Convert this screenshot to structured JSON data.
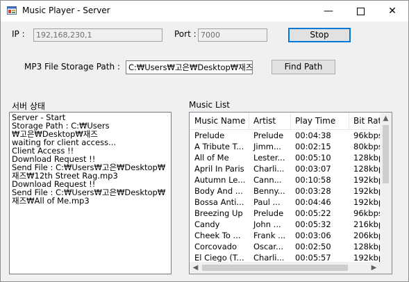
{
  "window": {
    "title": "Music Player - Server",
    "min_glyph": "—",
    "close_glyph": "✕"
  },
  "connection": {
    "ip_label": "IP :",
    "ip_value": "192,168,230,1",
    "port_label": "Port :",
    "port_value": "7000",
    "stop_label": "Stop"
  },
  "storage": {
    "path_label": "MP3 File Storage Path :",
    "path_value": "C:₩Users₩고은₩Desktop₩재즈",
    "find_label": "Find Path"
  },
  "server_status": {
    "heading": "서버 상태",
    "lines": [
      "Server - Start",
      "Storage Path : C:₩Users",
      "₩고은₩Desktop₩재즈",
      "waiting for client access...",
      "Client Access !!",
      "Download Request !!",
      "Send File : C:₩Users₩고은₩Desktop₩",
      "재즈₩12th Street Rag.mp3",
      "Download Request !!",
      "Send File : C:₩Users₩고은₩Desktop₩",
      "재즈₩All of Me.mp3"
    ]
  },
  "music_list": {
    "heading": "Music List",
    "columns": [
      "Music Name",
      "Artist",
      "Play Time",
      "Bit Rat"
    ],
    "rows": [
      [
        "Prelude",
        "Prelude",
        "00:04:38",
        "96kbps"
      ],
      [
        "A Tribute T...",
        "Jimm...",
        "00:02:15",
        "80kbps"
      ],
      [
        "All of Me",
        "Lester...",
        "00:05:10",
        "128kbp"
      ],
      [
        "April In Paris",
        "Charli...",
        "00:03:07",
        "128kbp"
      ],
      [
        "Autumn Le...",
        "Cann...",
        "00:10:58",
        "192kbp"
      ],
      [
        "Body And ...",
        "Benny...",
        "00:03:28",
        "192kbp"
      ],
      [
        "Bossa Anti...",
        "Paul ...",
        "00:04:46",
        "192kbp"
      ],
      [
        "Breezing Up",
        "Prelude",
        "00:05:22",
        "96kbps"
      ],
      [
        "Candy",
        "John ...",
        "00:05:32",
        "216kbp"
      ],
      [
        "Cheek To ...",
        "Frank ...",
        "00:03:06",
        "206kbp"
      ],
      [
        "Corcovado",
        "Oscar...",
        "00:02:50",
        "128kbp"
      ],
      [
        "El Ciego (T...",
        "Charli...",
        "00:05:57",
        "192kbp"
      ]
    ]
  },
  "colors": {
    "focus_border": "#0078d7",
    "window_bg": "#f0f0f0"
  }
}
